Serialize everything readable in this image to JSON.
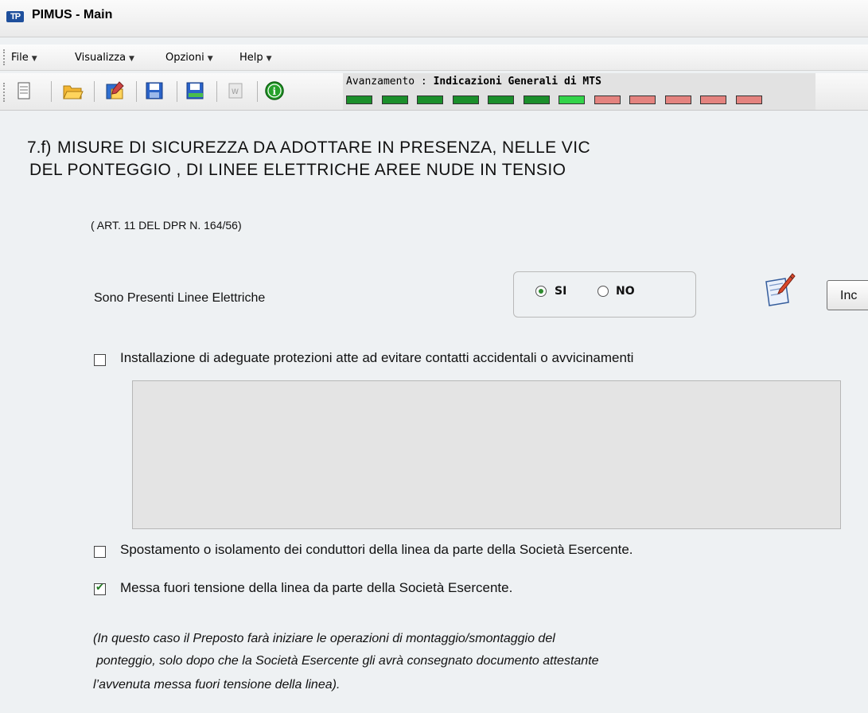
{
  "window": {
    "title": "PIMUS - Main",
    "logo_text": "TP"
  },
  "menu": {
    "items": [
      {
        "label": "File"
      },
      {
        "label": "Visualizza"
      },
      {
        "label": "Opzioni"
      },
      {
        "label": "Help"
      }
    ]
  },
  "toolbar": {
    "icons": [
      "new-document-icon",
      "open-folder-icon",
      "edit-document-icon",
      "save-icon",
      "save-as-icon",
      "word-export-icon",
      "info-icon"
    ]
  },
  "progress": {
    "label_prefix": "Avanzamento : ",
    "label_stage": "Indicazioni Generali di MTS",
    "cells": [
      "done",
      "done",
      "done",
      "done",
      "done",
      "done",
      "current",
      "todo",
      "todo",
      "todo",
      "todo",
      "todo"
    ],
    "colors": {
      "done": "#1b8f2b",
      "current": "#33d44a",
      "todo": "#e4837f"
    }
  },
  "section": {
    "number": "7.f)",
    "heading_line1": "MISURE DI SICUREZZA DA ADOTTARE IN PRESENZA, NELLE VIC",
    "heading_line2": "DEL PONTEGGIO , DI LINEE ELETTRICHE AREE NUDE IN TENSIO",
    "reference": "( ART. 11 DEL DPR N. 164/56)"
  },
  "question": {
    "label": "Sono Presenti Linee Elettriche",
    "options": [
      {
        "label": "SI",
        "selected": true
      },
      {
        "label": "NO",
        "selected": false
      }
    ],
    "button_label": "Inc"
  },
  "measures": [
    {
      "label": "Installazione di adeguate protezioni atte ad evitare contatti accidentali o avvicinamenti",
      "checked": false
    },
    {
      "label": "Spostamento o isolamento dei conduttori della linea da parte della Società Esercente.",
      "checked": false
    },
    {
      "label": "Messa fuori tensione della linea da parte della Società Esercente.",
      "checked": true
    }
  ],
  "note": {
    "line1": "(In questo caso il Preposto farà iniziare le operazioni di montaggio/smontaggio del",
    "line2": "ponteggio, solo dopo che la Società Esercente gli avrà consegnato documento attestante",
    "line3": "l’avvenuta messa fuori tensione della linea)."
  }
}
